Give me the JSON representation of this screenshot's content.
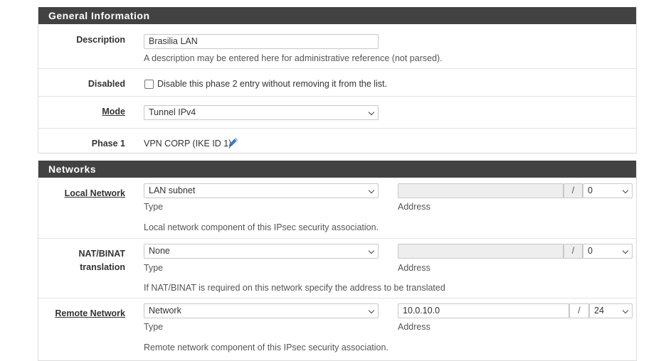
{
  "general": {
    "heading": "General Information",
    "description": {
      "label": "Description",
      "value": "Brasilia LAN",
      "help": "A description may be entered here for administrative reference (not parsed)."
    },
    "disabled": {
      "label": "Disabled",
      "checkbox_text": "Disable this phase 2 entry without removing it from the list.",
      "checked": false
    },
    "mode": {
      "label": "Mode",
      "value": "Tunnel IPv4"
    },
    "phase1": {
      "label": "Phase 1",
      "value": "VPN CORP (IKE ID 1)",
      "edit_icon": "pencil-icon"
    }
  },
  "networks": {
    "heading": "Networks",
    "local": {
      "label": "Local Network",
      "type_value": "LAN subnet",
      "type_caption": "Type",
      "address_value": "",
      "address_caption": "Address",
      "slash": "/",
      "mask": "0",
      "help": "Local network component of this IPsec security association."
    },
    "nat": {
      "label_line1": "NAT/BINAT",
      "label_line2": "translation",
      "type_value": "None",
      "type_caption": "Type",
      "address_value": "",
      "address_caption": "Address",
      "slash": "/",
      "mask": "0",
      "help": "If NAT/BINAT is required on this network specify the address to be translated"
    },
    "remote": {
      "label": "Remote Network",
      "type_value": "Network",
      "type_caption": "Type",
      "address_value": "10.0.10.0",
      "address_caption": "Address",
      "slash": "/",
      "mask": "24",
      "help": "Remote network component of this IPsec security association."
    }
  },
  "colors": {
    "heading_bg": "#424242",
    "pencil": "#3a7bc8"
  }
}
